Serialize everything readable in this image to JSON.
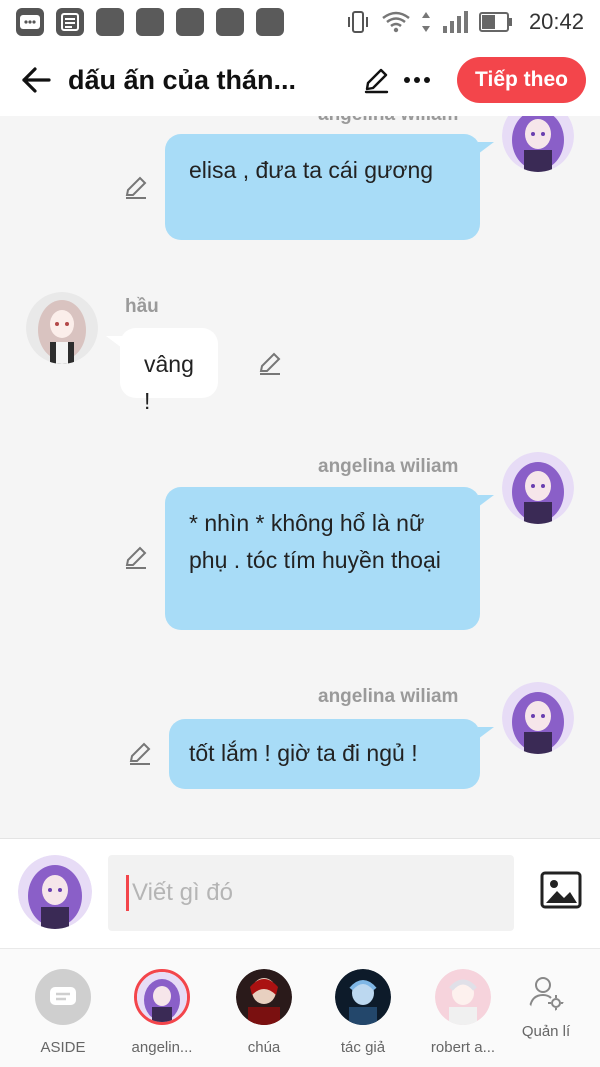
{
  "status_bar": {
    "time": "20:42"
  },
  "header": {
    "title": "dấu ấn của thán...",
    "next_button": "Tiếp theo"
  },
  "messages": [
    {
      "sender": "angelina wiliam",
      "text": "elisa , đưa ta cái gương",
      "side": "right"
    },
    {
      "sender": "hầu",
      "text": "vâng !",
      "side": "left"
    },
    {
      "sender": "angelina wiliam",
      "text": "* nhìn * không hổ là nữ phụ . tóc tím huyền thoại",
      "side": "right"
    },
    {
      "sender": "angelina wiliam",
      "text": "tốt lắm ! giờ ta đi ngủ !",
      "side": "right"
    }
  ],
  "composer": {
    "placeholder": "Viết gì đó"
  },
  "characters": [
    {
      "label": "ASIDE",
      "icon": "chat-bubble-icon"
    },
    {
      "label": "angelin...",
      "selected": true
    },
    {
      "label": "chúa"
    },
    {
      "label": "tác giả"
    },
    {
      "label": "robert a..."
    },
    {
      "label": "Quản lí",
      "icon": "person-settings-icon"
    }
  ],
  "colors": {
    "accent": "#f3454b",
    "bubble_right": "#a8dcf7",
    "bubble_left": "#ffffff",
    "background": "#f5f5f5"
  }
}
